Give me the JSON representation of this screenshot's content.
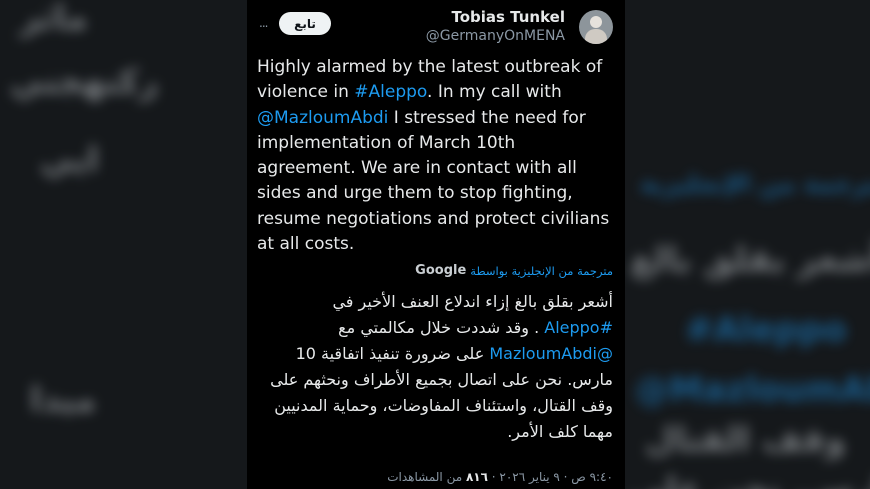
{
  "background": {
    "left_lines": [
      "ماثر",
      "ركنهجني",
      "ايي",
      "ميدا"
    ],
    "right_lines": [
      "مترجمة من الإنجليزية",
      "أشعر بقلق بالغ",
      "#Aleppo",
      "@MazloumAbdi",
      "وقف القتال",
      "مارس. نحن على"
    ]
  },
  "tweet": {
    "author_name": "Tobias Tunkel",
    "author_handle": "@GermanyOnMENA",
    "follow_label": "تابع",
    "more_icon": "...",
    "text_en": {
      "part1": "Highly alarmed by the latest outbreak of violence in ",
      "hashtag": "#Aleppo",
      "part2": ". In my call with ",
      "mention": "@MazloumAbdi",
      "part3": " I stressed the need for implementation of March 10th agreement. We are in contact with all sides and urge them to stop fighting, resume negotiations and protect civilians at all costs."
    },
    "translation_label": "مترجمة من الإنجليزية بواسطة",
    "translation_provider": "Google",
    "text_ar": {
      "line1": "أشعر بقلق بالغ إزاء اندلاع العنف الأخير في",
      "line2_hashtag": "#Aleppo",
      "line2_text": " . وقد شددت خلال مكالمتي مع",
      "line3_mention": "@MazloumAbdi",
      "line3_text": " على ضرورة تنفيذ اتفاقية 10",
      "line4": "مارس. نحن على اتصال بجميع الأطراف ونحثهم على",
      "line5": "وقف القتال، واستئناف المفاوضات، وحماية المدنيين",
      "line6": "مهما كلف الأمر."
    },
    "timestamp": "٩:٤٠ ص · ٩ يناير ٢٠٢٦ · ",
    "views_count": "٨١٦",
    "views_label": " من المشاهدات"
  },
  "colors": {
    "accent": "#1d9bf0",
    "card_bg": "#000000",
    "text_primary": "#e7e9ea",
    "text_secondary": "#8b98a5"
  }
}
